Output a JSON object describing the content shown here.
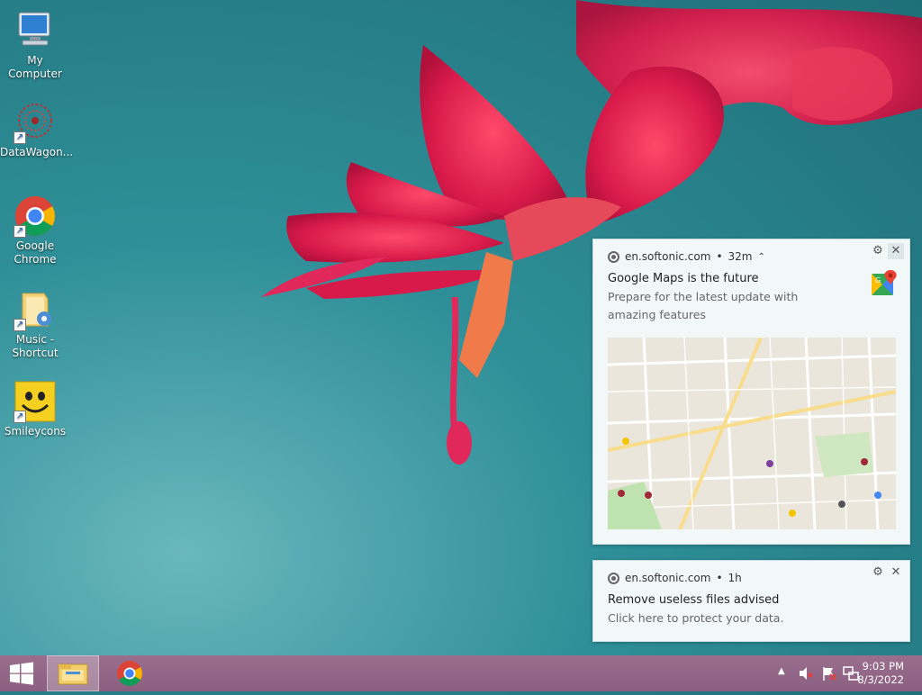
{
  "desktop": {
    "icons": [
      {
        "label": "My Computer",
        "icon": "computer-icon"
      },
      {
        "label": "DataWagon...",
        "icon": "datawagon-icon"
      },
      {
        "label": "Google Chrome",
        "icon": "chrome-icon"
      },
      {
        "label": "Music - Shortcut",
        "icon": "music-folder-icon"
      },
      {
        "label": "Smileycons",
        "icon": "smiley-icon"
      }
    ]
  },
  "notifications": [
    {
      "source": "en.softonic.com",
      "time": "32m",
      "title": "Google Maps is the future",
      "body": "Prepare for the latest update with amazing features",
      "app_icon": "google-maps-icon",
      "has_image": true
    },
    {
      "source": "en.softonic.com",
      "time": "1h",
      "title": "Remove useless files advised",
      "body": "Click here to protect your data."
    }
  ],
  "taskbar": {
    "clock_time": "9:03 PM",
    "clock_date": "8/3/2022",
    "pinned": [
      "file-explorer-icon",
      "chrome-icon"
    ],
    "tray_icons": [
      "show-hidden-icons",
      "volume-muted-icon",
      "action-center-flag-icon",
      "network-icon"
    ]
  },
  "colors": {
    "taskbar": "#8a5f80",
    "toast_bg": "#f2f7f8",
    "wallpaper": "#2f8f98"
  }
}
